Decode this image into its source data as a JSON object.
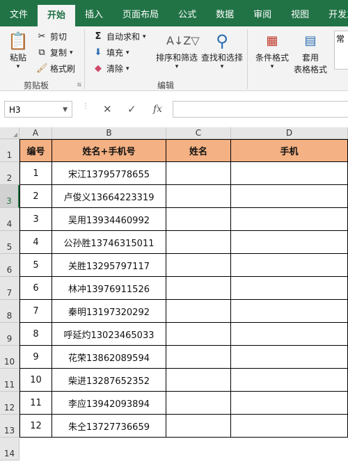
{
  "tabs": [
    "文件",
    "开始",
    "插入",
    "页面布局",
    "公式",
    "数据",
    "审阅",
    "视图",
    "开发工具"
  ],
  "ribbon": {
    "paste": "粘贴",
    "cut": "剪切",
    "copy": "复制",
    "format_painter": "格式刷",
    "clipboard_group": "剪贴板",
    "autosum": "自动求和",
    "fill": "填充",
    "clear": "清除",
    "sort_filter": "排序和筛选",
    "find_select": "查找和选择",
    "editing_group": "编辑",
    "cond_format": "条件格式",
    "table_format_1": "套用",
    "table_format_2": "表格格式",
    "style_partial": "常"
  },
  "formula_bar": {
    "name_box": "H3",
    "cancel": "✕",
    "enter": "✓",
    "fx": "fx",
    "value": ""
  },
  "columns": [
    "A",
    "B",
    "C",
    "D"
  ],
  "rows": [
    "1",
    "2",
    "3",
    "4",
    "5",
    "6",
    "7",
    "8",
    "9",
    "10",
    "11",
    "12",
    "13",
    "14"
  ],
  "table": {
    "headers": [
      "编号",
      "姓名+手机号",
      "姓名",
      "手机"
    ],
    "rows": [
      [
        "1",
        "宋江13795778655",
        "",
        ""
      ],
      [
        "2",
        "卢俊义13664223319",
        "",
        ""
      ],
      [
        "3",
        "吴用13934460992",
        "",
        ""
      ],
      [
        "4",
        "公孙胜13746315011",
        "",
        ""
      ],
      [
        "5",
        "关胜13295797117",
        "",
        ""
      ],
      [
        "6",
        "林冲13976911526",
        "",
        ""
      ],
      [
        "7",
        "秦明13197320292",
        "",
        ""
      ],
      [
        "8",
        "呼延灼13023465033",
        "",
        ""
      ],
      [
        "9",
        "花荣13862089594",
        "",
        ""
      ],
      [
        "10",
        "柴进13287652352",
        "",
        ""
      ],
      [
        "11",
        "李应13942093894",
        "",
        ""
      ],
      [
        "12",
        "朱仝13727736659",
        "",
        ""
      ]
    ]
  },
  "colors": {
    "accent": "#217346",
    "header_fill": "#f4b183"
  }
}
